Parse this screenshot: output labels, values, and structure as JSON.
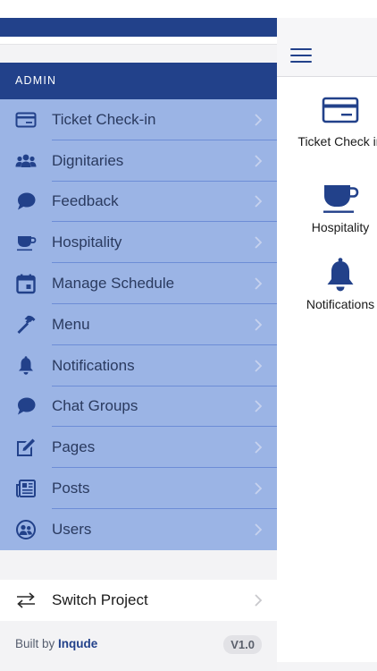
{
  "drawer": {
    "section_header": "ADMIN",
    "items": [
      {
        "label": "Ticket Check-in",
        "icon": "ticket-card-icon"
      },
      {
        "label": "Dignitaries",
        "icon": "people-group-icon"
      },
      {
        "label": "Feedback",
        "icon": "chat-bubble-icon"
      },
      {
        "label": "Hospitality",
        "icon": "coffee-cup-icon"
      },
      {
        "label": "Manage Schedule",
        "icon": "calendar-icon"
      },
      {
        "label": "Menu",
        "icon": "hammer-icon"
      },
      {
        "label": "Notifications",
        "icon": "bell-icon"
      },
      {
        "label": "Chat Groups",
        "icon": "chat-bubbles-icon"
      },
      {
        "label": "Pages",
        "icon": "edit-page-icon"
      },
      {
        "label": "Posts",
        "icon": "newspaper-icon"
      },
      {
        "label": "Users",
        "icon": "user-circle-icon"
      }
    ],
    "switch_project": {
      "label": "Switch Project",
      "icon": "swap-arrows-icon"
    },
    "footer": {
      "built_by": "Built by",
      "brand": "Inqude",
      "version": "V1.0"
    }
  },
  "main": {
    "tiles": [
      {
        "label": "Ticket Check in",
        "icon": "ticket-card-icon"
      },
      {
        "label": "Hospitality",
        "icon": "coffee-cup-icon"
      },
      {
        "label": "Notifications",
        "icon": "bell-icon"
      }
    ]
  },
  "colors": {
    "primary": "#22418a",
    "menu_background": "#9bb4e5",
    "separator": "#6d8dd6"
  }
}
